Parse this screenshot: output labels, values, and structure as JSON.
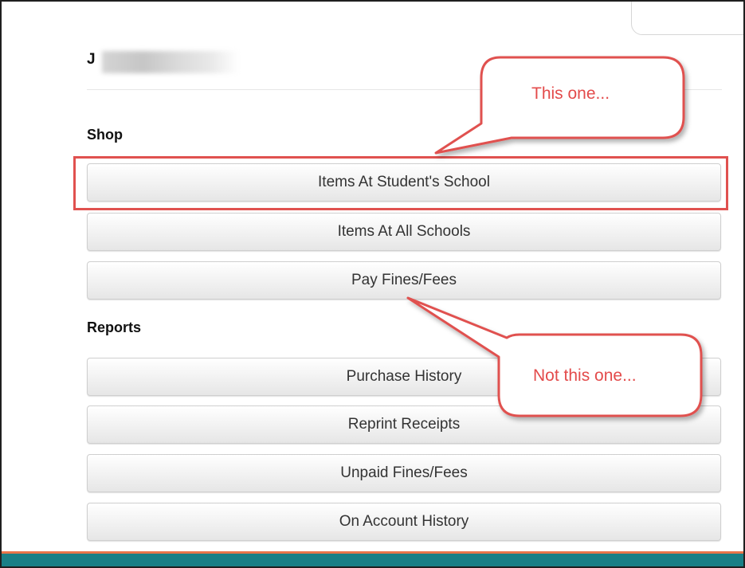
{
  "user": {
    "name_visible": "J"
  },
  "sections": {
    "shop": {
      "heading": "Shop",
      "buttons": [
        "Items At Student's School",
        "Items At All Schools",
        "Pay Fines/Fees"
      ]
    },
    "reports": {
      "heading": "Reports",
      "buttons": [
        "Purchase History",
        "Reprint Receipts",
        "Unpaid Fines/Fees",
        "On Account History"
      ]
    }
  },
  "annotations": {
    "this_one": "This one...",
    "not_this_one": "Not this one..."
  },
  "colors": {
    "annotation_red": "#e0514f",
    "bottom_bar": "#1a7f86",
    "bottom_bar_accent": "#e8744a"
  }
}
